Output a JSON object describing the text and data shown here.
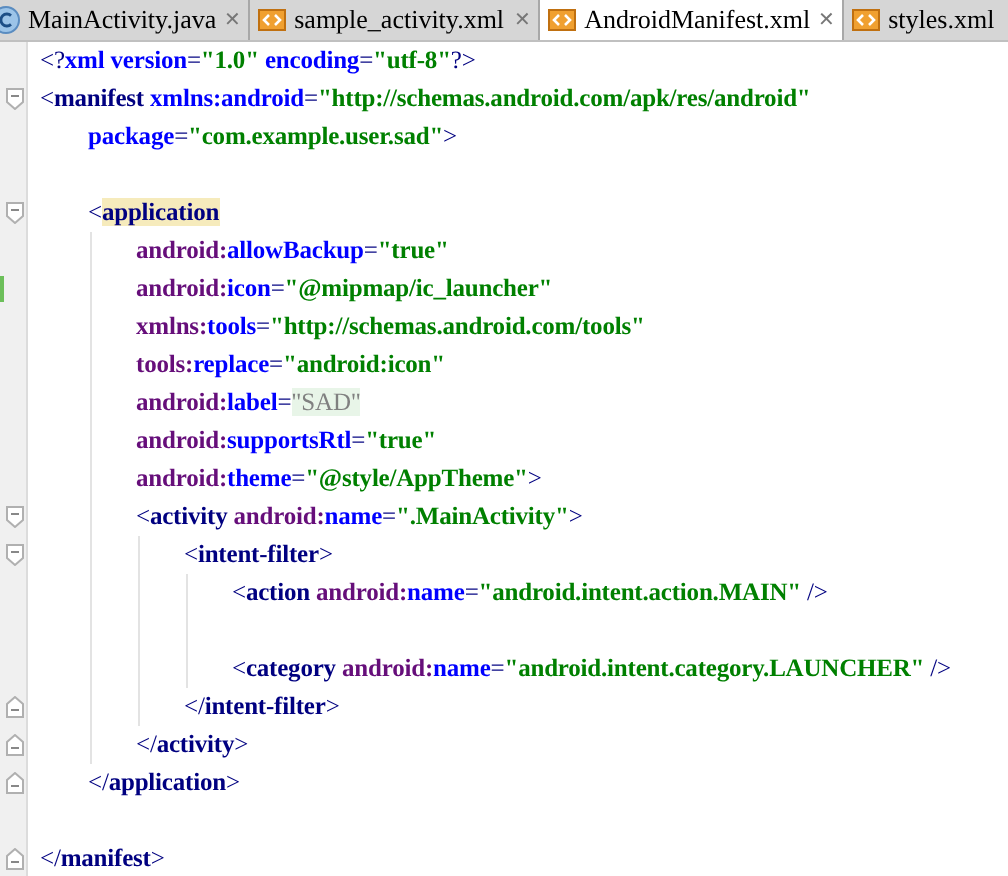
{
  "tabs": [
    {
      "label": "MainActivity.java",
      "kind": "java",
      "selected": false,
      "close": "✕"
    },
    {
      "label": "sample_activity.xml",
      "kind": "xml",
      "selected": false,
      "close": "✕"
    },
    {
      "label": "AndroidManifest.xml",
      "kind": "xml",
      "selected": true,
      "close": "✕"
    },
    {
      "label": "styles.xml",
      "kind": "xml",
      "selected": false
    }
  ],
  "editor": {
    "lines": [
      {
        "kind": "code",
        "tokens": [
          {
            "kind": "punct",
            "text": "<?"
          },
          {
            "kind": "keyword",
            "text": "xml"
          },
          {
            "kind": "attr",
            "text": " version"
          },
          {
            "kind": "punct",
            "text": "="
          },
          {
            "kind": "value",
            "text": "\"1.0\""
          },
          {
            "kind": "attr",
            "text": " encoding"
          },
          {
            "kind": "punct",
            "text": "="
          },
          {
            "kind": "value",
            "text": "\"utf-8\""
          },
          {
            "kind": "punct",
            "text": "?>"
          }
        ]
      },
      {
        "kind": "code",
        "fold_start": true,
        "tokens": [
          {
            "kind": "punct",
            "text": "<"
          },
          {
            "kind": "tag",
            "text": "manifest"
          },
          {
            "kind": "attr",
            "text": " xmlns:android"
          },
          {
            "kind": "punct",
            "text": "="
          },
          {
            "kind": "value",
            "text": "\"http://schemas.android.com/apk/res/android\""
          }
        ],
        "children": [
          {
            "kind": "code",
            "tokens": [
              {
                "kind": "attr",
                "text": "package"
              },
              {
                "kind": "punct",
                "text": "="
              },
              {
                "kind": "value",
                "text": "\"com.example.user.sad\""
              },
              {
                "kind": "punct",
                "text": ">"
              }
            ]
          },
          {
            "kind": "blank"
          },
          {
            "kind": "code",
            "fold_start": true,
            "tokens": [
              {
                "kind": "punct",
                "text": "<"
              },
              {
                "kind": "tag",
                "text": "application",
                "highlight": true
              }
            ],
            "children": [
              {
                "kind": "code",
                "tokens": [
                  {
                    "kind": "ns",
                    "text": "android:"
                  },
                  {
                    "kind": "attr",
                    "text": "allowBackup"
                  },
                  {
                    "kind": "punct",
                    "text": "="
                  },
                  {
                    "kind": "value",
                    "text": "\"true\""
                  }
                ]
              },
              {
                "kind": "code",
                "changed": true,
                "tokens": [
                  {
                    "kind": "ns",
                    "text": "android:"
                  },
                  {
                    "kind": "attr",
                    "text": "icon"
                  },
                  {
                    "kind": "punct",
                    "text": "="
                  },
                  {
                    "kind": "value",
                    "text": "\"@mipmap/ic_launcher\""
                  }
                ]
              },
              {
                "kind": "code",
                "tokens": [
                  {
                    "kind": "ns",
                    "text": "xmlns:"
                  },
                  {
                    "kind": "attr",
                    "text": "tools"
                  },
                  {
                    "kind": "punct",
                    "text": "="
                  },
                  {
                    "kind": "value",
                    "text": "\"http://schemas.android.com/tools\""
                  }
                ]
              },
              {
                "kind": "code",
                "tokens": [
                  {
                    "kind": "ns",
                    "text": "tools:"
                  },
                  {
                    "kind": "attr",
                    "text": "replace"
                  },
                  {
                    "kind": "punct",
                    "text": "="
                  },
                  {
                    "kind": "value",
                    "text": "\"android:icon\""
                  }
                ]
              },
              {
                "kind": "code",
                "tokens": [
                  {
                    "kind": "ns",
                    "text": "android:"
                  },
                  {
                    "kind": "attr",
                    "text": "label"
                  },
                  {
                    "kind": "punct",
                    "text": "="
                  },
                  {
                    "kind": "folded",
                    "text": "\"SAD\""
                  }
                ]
              },
              {
                "kind": "code",
                "tokens": [
                  {
                    "kind": "ns",
                    "text": "android:"
                  },
                  {
                    "kind": "attr",
                    "text": "supportsRtl"
                  },
                  {
                    "kind": "punct",
                    "text": "="
                  },
                  {
                    "kind": "value",
                    "text": "\"true\""
                  }
                ]
              },
              {
                "kind": "code",
                "tokens": [
                  {
                    "kind": "ns",
                    "text": "android:"
                  },
                  {
                    "kind": "attr",
                    "text": "theme"
                  },
                  {
                    "kind": "punct",
                    "text": "="
                  },
                  {
                    "kind": "value",
                    "text": "\"@style/AppTheme\""
                  },
                  {
                    "kind": "punct",
                    "text": ">"
                  }
                ]
              },
              {
                "kind": "code",
                "fold_start": true,
                "tokens": [
                  {
                    "kind": "punct",
                    "text": "<"
                  },
                  {
                    "kind": "tag",
                    "text": "activity"
                  },
                  {
                    "kind": "ns",
                    "text": " android:"
                  },
                  {
                    "kind": "attr",
                    "text": "name"
                  },
                  {
                    "kind": "punct",
                    "text": "="
                  },
                  {
                    "kind": "value",
                    "text": "\".MainActivity\""
                  },
                  {
                    "kind": "punct",
                    "text": ">"
                  }
                ],
                "children": [
                  {
                    "kind": "code",
                    "fold_start": true,
                    "tokens": [
                      {
                        "kind": "punct",
                        "text": "<"
                      },
                      {
                        "kind": "tag",
                        "text": "intent-filter"
                      },
                      {
                        "kind": "punct",
                        "text": ">"
                      }
                    ],
                    "children": [
                      {
                        "kind": "code",
                        "tokens": [
                          {
                            "kind": "punct",
                            "text": "<"
                          },
                          {
                            "kind": "tag",
                            "text": "action"
                          },
                          {
                            "kind": "ns",
                            "text": " android:"
                          },
                          {
                            "kind": "attr",
                            "text": "name"
                          },
                          {
                            "kind": "punct",
                            "text": "="
                          },
                          {
                            "kind": "value",
                            "text": "\"android.intent.action.MAIN\""
                          },
                          {
                            "kind": "punct",
                            "text": " />"
                          }
                        ]
                      },
                      {
                        "kind": "blank"
                      },
                      {
                        "kind": "code",
                        "tokens": [
                          {
                            "kind": "punct",
                            "text": "<"
                          },
                          {
                            "kind": "tag",
                            "text": "category"
                          },
                          {
                            "kind": "ns",
                            "text": " android:"
                          },
                          {
                            "kind": "attr",
                            "text": "name"
                          },
                          {
                            "kind": "punct",
                            "text": "="
                          },
                          {
                            "kind": "value",
                            "text": "\"android.intent.category.LAUNCHER\""
                          },
                          {
                            "kind": "punct",
                            "text": " />"
                          }
                        ]
                      }
                    ]
                  },
                  {
                    "kind": "code",
                    "fold_end": true,
                    "tokens": [
                      {
                        "kind": "punct",
                        "text": "</"
                      },
                      {
                        "kind": "tag",
                        "text": "intent-filter"
                      },
                      {
                        "kind": "punct",
                        "text": ">"
                      }
                    ]
                  }
                ]
              },
              {
                "kind": "code",
                "fold_end": true,
                "tokens": [
                  {
                    "kind": "punct",
                    "text": "</"
                  },
                  {
                    "kind": "tag",
                    "text": "activity"
                  },
                  {
                    "kind": "punct",
                    "text": ">"
                  }
                ]
              }
            ]
          },
          {
            "kind": "code",
            "fold_end": true,
            "tokens": [
              {
                "kind": "punct",
                "text": "</"
              },
              {
                "kind": "tag",
                "text": "application"
              },
              {
                "kind": "punct",
                "text": ">"
              }
            ]
          },
          {
            "kind": "blank"
          }
        ]
      },
      {
        "kind": "code",
        "fold_end": true,
        "tokens": [
          {
            "kind": "punct",
            "text": "</"
          },
          {
            "kind": "tag",
            "text": "manifest"
          },
          {
            "kind": "punct",
            "text": ">"
          }
        ]
      }
    ]
  }
}
